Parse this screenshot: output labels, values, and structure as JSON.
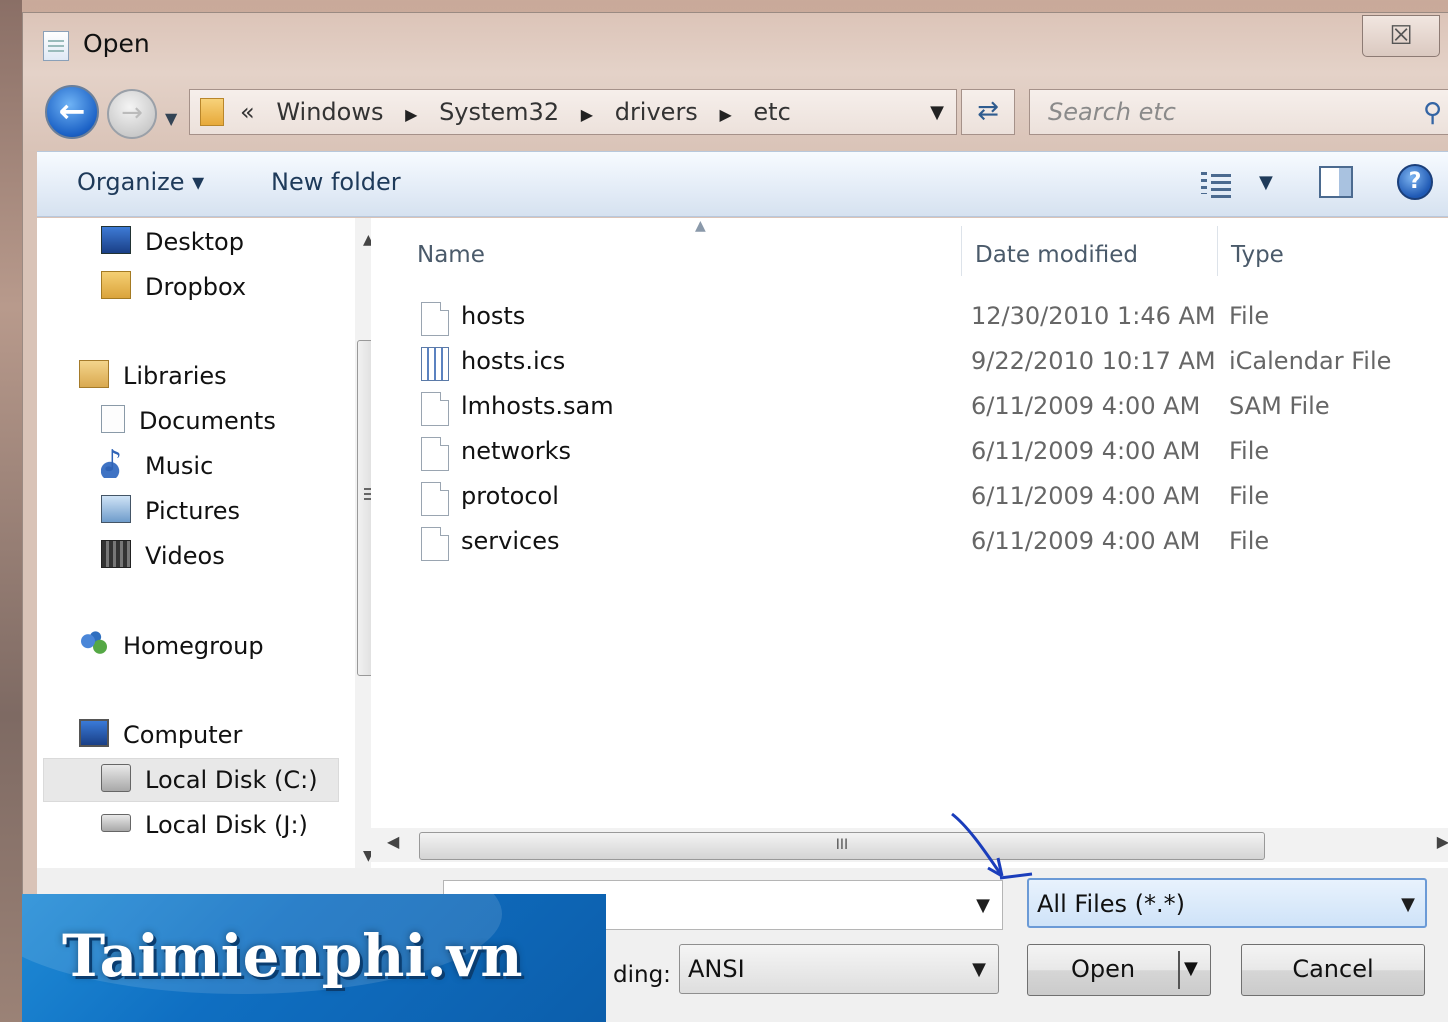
{
  "window": {
    "title": "Open",
    "close_glyph": "☒"
  },
  "address": {
    "prefix": "«",
    "crumbs": [
      "Windows",
      "System32",
      "drivers",
      "etc"
    ]
  },
  "search": {
    "placeholder": "Search etc",
    "icon": "search-icon"
  },
  "toolbar": {
    "organize": "Organize ▾",
    "new_folder": "New folder"
  },
  "nav": {
    "favorites": [
      {
        "label": "Desktop",
        "icon": "desktop-icon"
      },
      {
        "label": "Dropbox",
        "icon": "dropbox-icon"
      }
    ],
    "libraries": {
      "label": "Libraries",
      "icon": "libraries-icon"
    },
    "library_items": [
      {
        "label": "Documents",
        "icon": "documents-icon"
      },
      {
        "label": "Music",
        "icon": "music-icon"
      },
      {
        "label": "Pictures",
        "icon": "pictures-icon"
      },
      {
        "label": "Videos",
        "icon": "videos-icon"
      }
    ],
    "homegroup": {
      "label": "Homegroup",
      "icon": "homegroup-icon"
    },
    "computer": {
      "label": "Computer",
      "icon": "computer-icon"
    },
    "drives": [
      {
        "label": "Local Disk (C:)",
        "icon": "drive-icon",
        "selected": true
      },
      {
        "label": "Local Disk (J:)",
        "icon": "drive-icon",
        "selected": false
      }
    ]
  },
  "columns": {
    "name": "Name",
    "date": "Date modified",
    "type": "Type"
  },
  "files": [
    {
      "name": "hosts",
      "date": "12/30/2010 1:46 AM",
      "type": "File",
      "icon": "file-icon"
    },
    {
      "name": "hosts.ics",
      "date": "9/22/2010 10:17 AM",
      "type": "iCalendar File",
      "icon": "calendar-file-icon"
    },
    {
      "name": "lmhosts.sam",
      "date": "6/11/2009 4:00 AM",
      "type": "SAM File",
      "icon": "file-icon"
    },
    {
      "name": "networks",
      "date": "6/11/2009 4:00 AM",
      "type": "File",
      "icon": "file-icon"
    },
    {
      "name": "protocol",
      "date": "6/11/2009 4:00 AM",
      "type": "File",
      "icon": "file-icon"
    },
    {
      "name": "services",
      "date": "6/11/2009 4:00 AM",
      "type": "File",
      "icon": "file-icon"
    }
  ],
  "bottom": {
    "filename_value": "",
    "filter_value": "All Files  (*.*)",
    "encoding_label": "ding:",
    "encoding_value": "ANSI",
    "open_label": "Open",
    "cancel_label": "Cancel"
  },
  "watermark": {
    "text": "Taimienphi.vn"
  },
  "colors": {
    "toolbar_top": "#f7fbff",
    "filter_accent": "#6b9ad6",
    "watermark_bg": "#0f6fc2"
  }
}
